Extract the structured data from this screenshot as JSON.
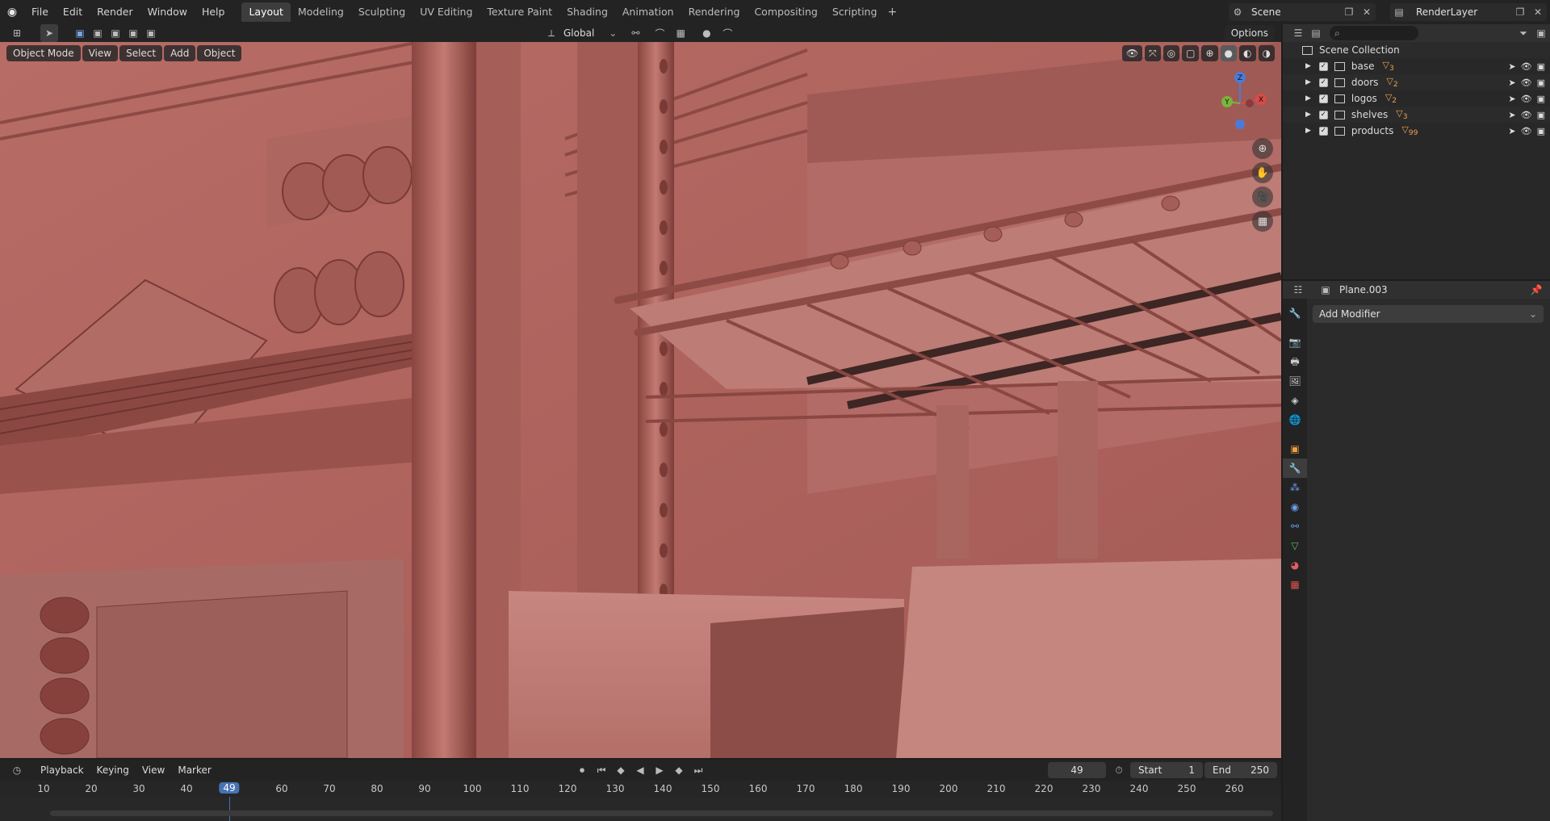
{
  "menu": {
    "items": [
      "File",
      "Edit",
      "Render",
      "Window",
      "Help"
    ]
  },
  "workspaces": {
    "tabs": [
      "Layout",
      "Modeling",
      "Sculpting",
      "UV Editing",
      "Texture Paint",
      "Shading",
      "Animation",
      "Rendering",
      "Compositing",
      "Scripting"
    ],
    "active": "Layout"
  },
  "scene": {
    "name": "Scene",
    "render_layer": "RenderLayer"
  },
  "tool_header": {
    "transform_orientation": "Global",
    "options": "Options"
  },
  "viewport": {
    "mode": "Object Mode",
    "menus": [
      "View",
      "Select",
      "Add",
      "Object"
    ],
    "axes": {
      "x": "X",
      "y": "Y",
      "z": "Z"
    }
  },
  "outliner": {
    "root": "Scene Collection",
    "collections": [
      {
        "name": "base",
        "count": "3"
      },
      {
        "name": "doors",
        "count": "2"
      },
      {
        "name": "logos",
        "count": "2"
      },
      {
        "name": "shelves",
        "count": "3"
      },
      {
        "name": "products",
        "count": "99"
      }
    ]
  },
  "properties": {
    "object_name": "Plane.003",
    "add_modifier": "Add Modifier"
  },
  "timeline": {
    "menus": [
      "Playback",
      "Keying",
      "View",
      "Marker"
    ],
    "current_frame": "49",
    "start_label": "Start",
    "start": "1",
    "end_label": "End",
    "end": "250",
    "ticks": [
      "10",
      "20",
      "30",
      "40",
      "60",
      "70",
      "80",
      "90",
      "100",
      "110",
      "120",
      "130",
      "140",
      "150",
      "160",
      "170",
      "180",
      "190",
      "200",
      "210",
      "220",
      "230",
      "240",
      "250",
      "260"
    ]
  },
  "colors": {
    "viewport_bg": "#a9625e",
    "accent": "#4772b3",
    "header": "#232323"
  }
}
